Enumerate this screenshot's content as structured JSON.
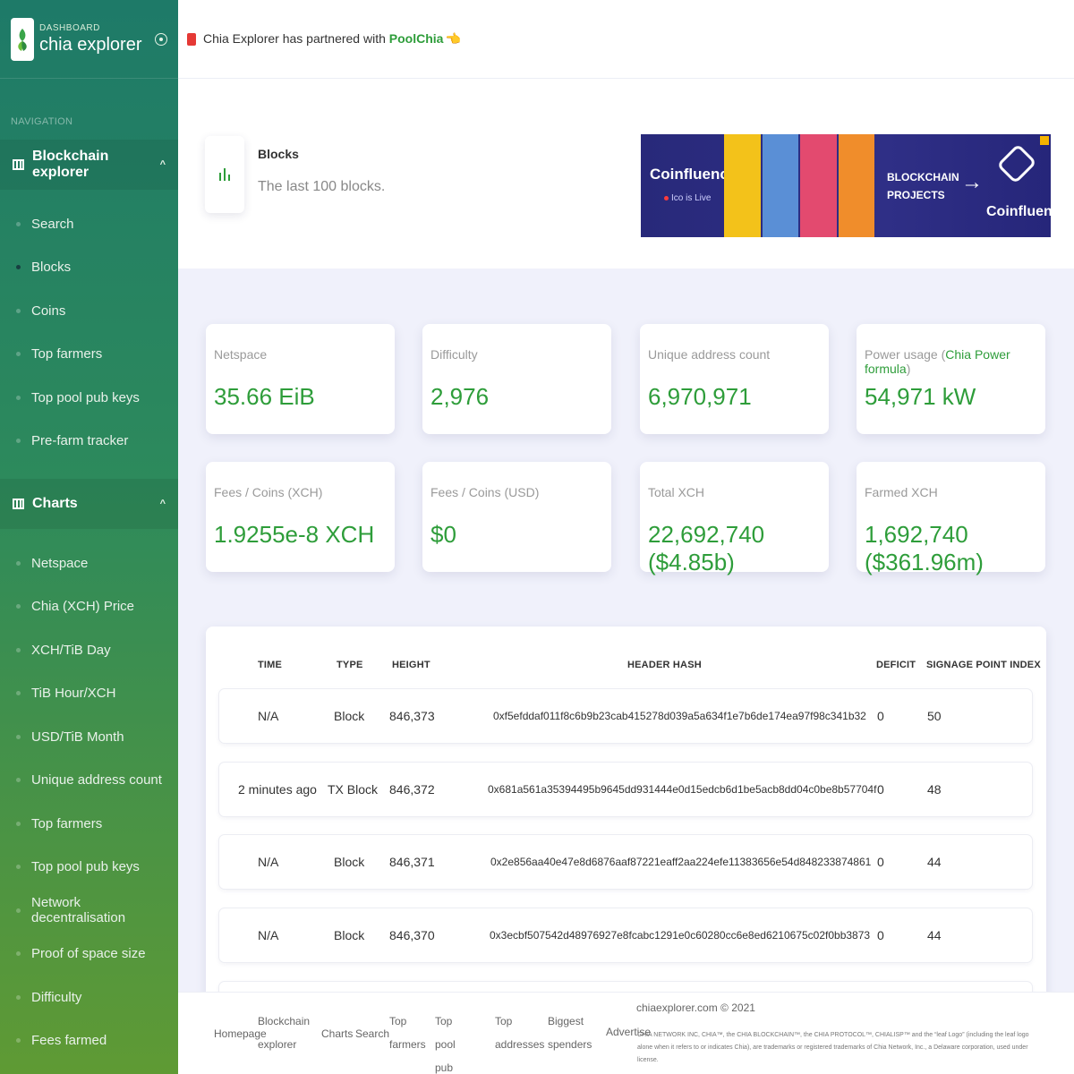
{
  "sidebar": {
    "brand_sub": "DASHBOARD",
    "brand_title": "chia explorer",
    "nav_heading": "NAVIGATION",
    "sections": [
      {
        "label": "Blockchain explorer",
        "caret": "^",
        "items": [
          {
            "label": "Search"
          },
          {
            "label": "Blocks",
            "active": true
          },
          {
            "label": "Coins"
          },
          {
            "label": "Top farmers"
          },
          {
            "label": "Top pool pub keys"
          },
          {
            "label": "Pre-farm tracker"
          }
        ]
      },
      {
        "label": "Charts",
        "caret": "^",
        "items": [
          {
            "label": "Netspace"
          },
          {
            "label": "Chia (XCH) Price"
          },
          {
            "label": "XCH/TiB Day"
          },
          {
            "label": "TiB Hour/XCH"
          },
          {
            "label": "USD/TiB Month"
          },
          {
            "label": "Unique address count"
          },
          {
            "label": "Top farmers"
          },
          {
            "label": "Top pool pub keys"
          },
          {
            "label": "Network decentralisation"
          },
          {
            "label": "Proof of space size"
          },
          {
            "label": "Difficulty"
          },
          {
            "label": "Fees farmed"
          }
        ]
      }
    ]
  },
  "topbar": {
    "announcement_prefix": "Chia Explorer has partnered with ",
    "announcement_link": "PoolChia",
    "announcement_emoji": "👈"
  },
  "page_header": {
    "title": "Blocks",
    "subtitle": "The last 100 blocks."
  },
  "ad": {
    "brand": "Coinfluence",
    "brand_sub": "Ico is Live",
    "headline_line1": "BLOCKCHAIN",
    "headline_line2": "PROJECTS",
    "arrow": "→",
    "logo_text": "Coinfluence"
  },
  "stats": [
    {
      "label": "Netspace",
      "value": "35.66 EiB"
    },
    {
      "label": "Difficulty",
      "value": "2,976"
    },
    {
      "label": "Unique address count",
      "value": "6,970,971"
    },
    {
      "label_prefix": "Power usage (",
      "label_link": "Chia Power formula",
      "label_suffix": ")",
      "value": "54,971 kW"
    },
    {
      "label": "Fees / Coins (XCH)",
      "value": "1.9255e-8 XCH"
    },
    {
      "label": "Fees / Coins (USD)",
      "value": "$0"
    },
    {
      "label": "Total XCH",
      "value": "22,692,740 ($4.85b)"
    },
    {
      "label": "Farmed XCH",
      "value": "1,692,740 ($361.96m)"
    }
  ],
  "table": {
    "headers": {
      "time": "TIME",
      "type": "TYPE",
      "height": "HEIGHT",
      "hash": "HEADER HASH",
      "deficit": "DEFICIT",
      "spi": "SIGNAGE POINT INDEX"
    },
    "rows": [
      {
        "time": "N/A",
        "type": "Block",
        "height": "846,373",
        "hash": "0xf5efddaf011f8c6b9b23cab415278d039a5a634f1e7b6de174ea97f98c341b32",
        "deficit": "0",
        "spi": "50"
      },
      {
        "time": "2 minutes ago",
        "type": "TX Block",
        "height": "846,372",
        "hash": "0x681a561a35394495b9645dd931444e0d15edcb6d1be5acb8dd04c0be8b57704f",
        "deficit": "0",
        "spi": "48"
      },
      {
        "time": "N/A",
        "type": "Block",
        "height": "846,371",
        "hash": "0x2e856aa40e47e8d6876aaf87221eaff2aa224efe11383656e54d848233874861",
        "deficit": "0",
        "spi": "44"
      },
      {
        "time": "N/A",
        "type": "Block",
        "height": "846,370",
        "hash": "0x3ecbf507542d48976927e8fcabc1291e0c60280cc6e8ed6210675c02f0bb3873",
        "deficit": "0",
        "spi": "44"
      }
    ]
  },
  "footer": {
    "links": [
      {
        "label": "Homepage"
      },
      {
        "label": "Blockchain explorer"
      },
      {
        "label": "Charts"
      },
      {
        "label": "Search"
      },
      {
        "label": "Top farmers"
      },
      {
        "label": "Top pool pub keys"
      },
      {
        "label": "Top addresses"
      },
      {
        "label": "Biggest spenders"
      }
    ],
    "copyright": "chiaexplorer.com © 2021",
    "advertise": "Advertise",
    "legal": "CHIA NETWORK INC, CHIA™, the CHIA BLOCKCHAIN™, the CHIA PROTOCOL™, CHIALISP™ and the “leaf Logo” (including the leaf logo alone when it refers to or indicates Chia), are trademarks or registered trademarks of Chia Network, Inc., a Delaware corporation, used under license."
  },
  "colors": {
    "accent_green": "#2e9d3a",
    "sidebar_top": "#1e7a68",
    "sidebar_bottom": "#5f9a34",
    "ad_bg": "#2f2f86"
  }
}
